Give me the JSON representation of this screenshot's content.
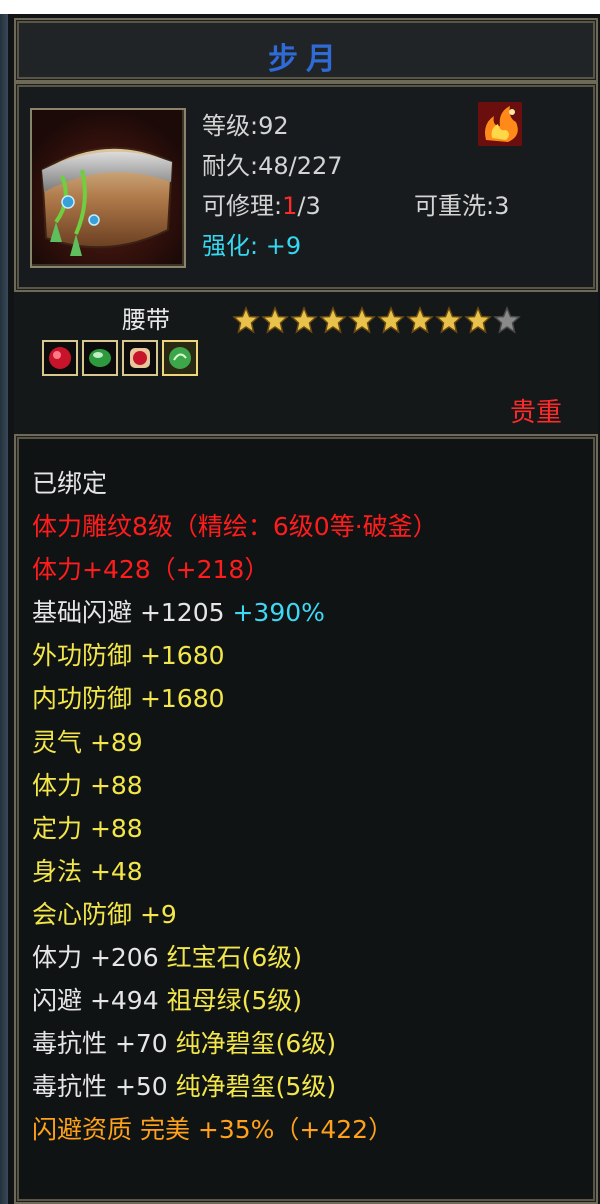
{
  "item": {
    "name": "步月",
    "level_text": "等级:92",
    "durability_text": "耐久:48/227",
    "repair_prefix": "可修理:",
    "repair_used": "1",
    "repair_total": "/3",
    "rewash_text": "可重洗:3",
    "enhance_label": "强化: ",
    "enhance_value": "+9",
    "type": "腰带",
    "stars": 9,
    "stars_max": 10,
    "gems": [
      "red-gem-icon",
      "green-gem-icon",
      "ruby-gem-icon",
      "jade-gem-icon"
    ],
    "quality": "贵重",
    "icon": "belt-icon"
  },
  "attributes": [
    {
      "text": "已绑定",
      "color": "white"
    },
    {
      "text": "体力雕纹8级（精绘：6级0等·破釜）",
      "color": "red"
    },
    {
      "text": "体力+428（+218）",
      "color": "red"
    },
    {
      "text": "基础闪避 +1205",
      "extra": "+390%",
      "color": "white",
      "extra_color": "cyan"
    },
    {
      "text": "外功防御 +1680",
      "color": "yellow"
    },
    {
      "text": "内功防御 +1680",
      "color": "yellow"
    },
    {
      "text": "灵气 +89",
      "color": "yellow"
    },
    {
      "text": "体力 +88",
      "color": "yellow"
    },
    {
      "text": "定力 +88",
      "color": "yellow"
    },
    {
      "text": "身法 +48",
      "color": "yellow"
    },
    {
      "text": "会心防御 +9",
      "color": "yellow"
    },
    {
      "text": "体力 +206",
      "extra": "红宝石(6级)",
      "color": "white",
      "extra_color": "yellow"
    },
    {
      "text": "闪避 +494",
      "extra": "祖母绿(5级)",
      "color": "white",
      "extra_color": "yellow"
    },
    {
      "text": "毒抗性 +70",
      "extra": "纯净碧玺(6级)",
      "color": "white",
      "extra_color": "yellow"
    },
    {
      "text": "毒抗性 +50",
      "extra": "纯净碧玺(5级)",
      "color": "white",
      "extra_color": "yellow"
    },
    {
      "text": "闪避资质  完美 +35%（+422）",
      "color": "orange"
    }
  ],
  "colors": {
    "title": "#2f6bd6",
    "red": "#ff1c1c",
    "yellow": "#f2e64a",
    "cyan": "#3ed8f4",
    "orange": "#ffa11a",
    "white": "#e6e6e6"
  }
}
